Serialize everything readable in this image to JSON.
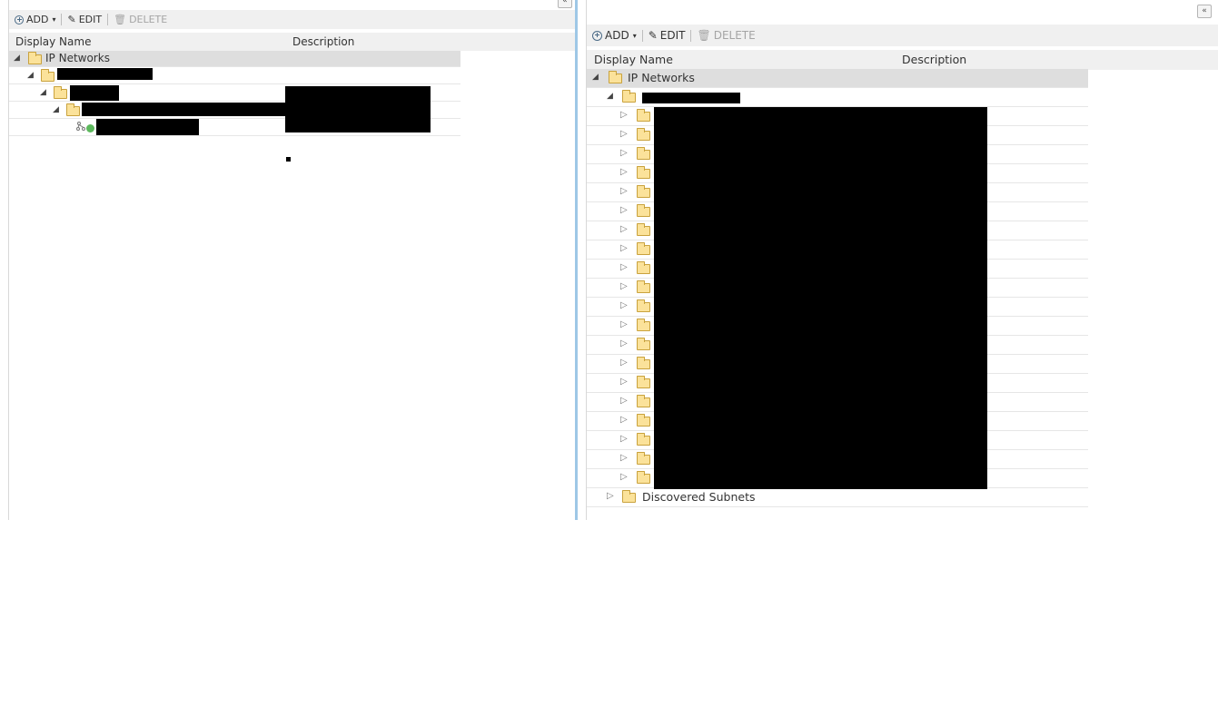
{
  "toolbar": {
    "add_label": "ADD",
    "edit_label": "EDIT",
    "delete_label": "DELETE"
  },
  "columns": {
    "display_name": "Display Name",
    "description": "Description"
  },
  "tree": {
    "root_label": "IP Networks",
    "discovered_label": "Discovered Subnets"
  },
  "collapse_icon": "«",
  "colors": {
    "folder": "#fbe29a",
    "splitter": "#9ec7e6",
    "status": "#5cb85c"
  }
}
